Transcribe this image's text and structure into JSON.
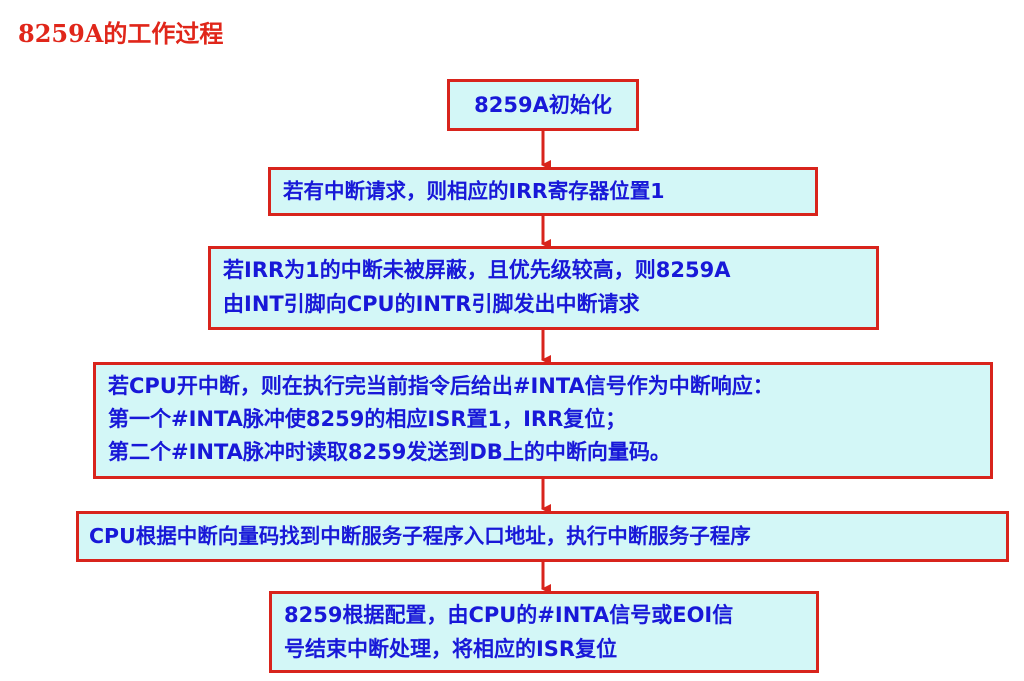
{
  "title": "8259A的工作过程",
  "accent_colors": {
    "border": "#d8241c",
    "fill": "#d3f7f7",
    "text": "#1818d8",
    "title": "#e0261a"
  },
  "steps": [
    {
      "lines": [
        "8259A初始化"
      ]
    },
    {
      "lines": [
        "若有中断请求，则相应的IRR寄存器位置1"
      ]
    },
    {
      "lines": [
        "若IRR为1的中断未被屏蔽，且优先级较高，则8259A",
        "由INT引脚向CPU的INTR引脚发出中断请求"
      ]
    },
    {
      "lines": [
        "若CPU开中断，则在执行完当前指令后给出#INTA信号作为中断响应：",
        "第一个#INTA脉冲使8259的相应ISR置1，IRR复位；",
        "第二个#INTA脉冲时读取8259发送到DB上的中断向量码。"
      ]
    },
    {
      "lines": [
        "CPU根据中断向量码找到中断服务子程序入口地址，执行中断服务子程序"
      ]
    },
    {
      "lines": [
        "8259根据配置，由CPU的#INTA信号或EOI信",
        "号结束中断处理，将相应的ISR复位"
      ]
    }
  ]
}
